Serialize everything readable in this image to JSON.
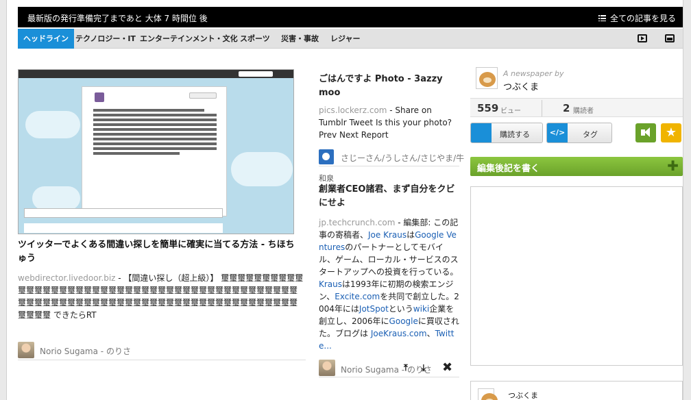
{
  "topbar": {
    "message": "最新版の発行準備完了まであと 大体 7 時間位 後",
    "all_articles": "全ての記事を見る"
  },
  "nav": {
    "tabs": [
      "ヘッドライン",
      "テクノロジー・IT",
      "エンターテインメント・文化",
      "スポーツ",
      "災害・事故",
      "レジャー"
    ],
    "active_tab": "ヘッドライン",
    "icons": [
      "video-icon",
      "photo-icon"
    ]
  },
  "article1": {
    "title": "ツイッターでよくある間違い探しを簡単に確実に当てる方法 - ちほちゅう",
    "source": "webdirector.livedoor.biz",
    "body": " - 【間違い探し（超上級）】 璽璽璽璽璽璽璽璽璽璽璽璽璽璽璽璽璽璽璽璽璽璽璽璽璽璽璽璽璽璽璽璽璽璽璽璽璽璽璽璽璽璽璽璽璽璽璽璽璽璽璽璽璽璽璽璽璽璽璽璽璽璽璽璽璽璽璽璽璽璽璽璽璽璽璽璽璽璽璽璽璽璽 できたらRT",
    "author": "Norio Sugama - のりさ"
  },
  "article2": {
    "title": "ごはんですよ Photo - 3azzy moo",
    "source": "pics.lockerz.com",
    "body": " - Share on Tumblr Tweet Is this your photo? Prev Next Report",
    "author": "さじーさん/うしさん/さじやま/牛"
  },
  "article3": {
    "kicker": "和泉",
    "title": "創業者CEO諸君、まず自分をクビにせよ",
    "source": "jp.techcrunch.com",
    "body_parts": [
      " - 編集部: この記事の寄稿者、",
      "Joe Kraus",
      "は",
      "Google Ventures",
      "のパートナーとしてモバイル、ゲーム、ローカル・サービスのスタートアップへの投資を行っている。",
      "Kraus",
      "は1993年に初期の検索エンジン、",
      "Excite.com",
      "を共同で創立した。2004年には",
      "JotSpot",
      "という",
      "wiki",
      "企業を創立し、2006年に",
      "Google",
      "に買収された。ブログは ",
      "JoeKraus.com",
      "、",
      "Twitte..."
    ],
    "author": "Norio Sugama - のりさ"
  },
  "sidebar": {
    "by_label": "A newspaper by",
    "name": "つぶくま",
    "views": "559",
    "views_label": "ビュー",
    "subscribers": "2",
    "subscribers_label": "購読者",
    "subscribe_button": "購読する",
    "tag_button": "タグ",
    "write_postscript": "編集後記を書く",
    "bottom_name": "つぶくま"
  },
  "colors": {
    "nav_active": "#1a8fd8",
    "write_bar": "#7ab534",
    "star": "#f0b400",
    "megaphone": "#6aa22a"
  }
}
